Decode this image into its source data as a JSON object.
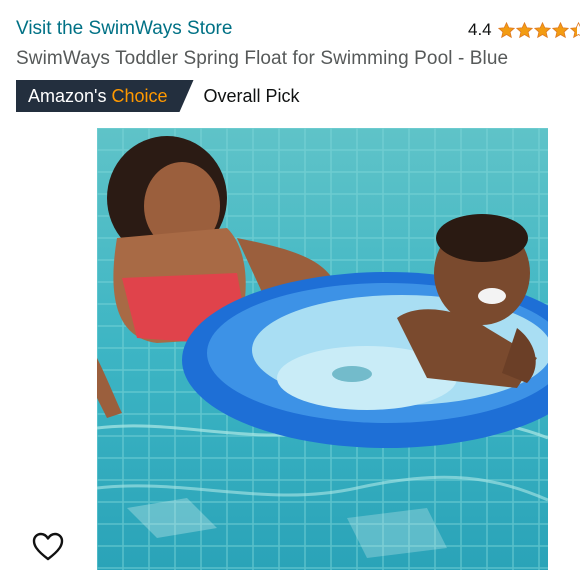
{
  "store": {
    "link_text": "Visit the SwimWays Store"
  },
  "rating": {
    "value": "4.4",
    "stars": 4.4,
    "color": "#f39c12"
  },
  "product": {
    "title": "SwimWays Toddler Spring Float for Swimming Pool - Blue"
  },
  "badge": {
    "prefix": "Amazon's",
    "accent": "Choice",
    "note": "Overall Pick"
  },
  "image": {
    "alt": "Woman and smiling toddler with a blue spring float in a swimming pool"
  },
  "actions": {
    "wishlist_icon": "heart-outline-icon"
  },
  "colors": {
    "link": "#007185",
    "badge_bg": "#232f3e",
    "badge_accent": "#ff9900"
  }
}
